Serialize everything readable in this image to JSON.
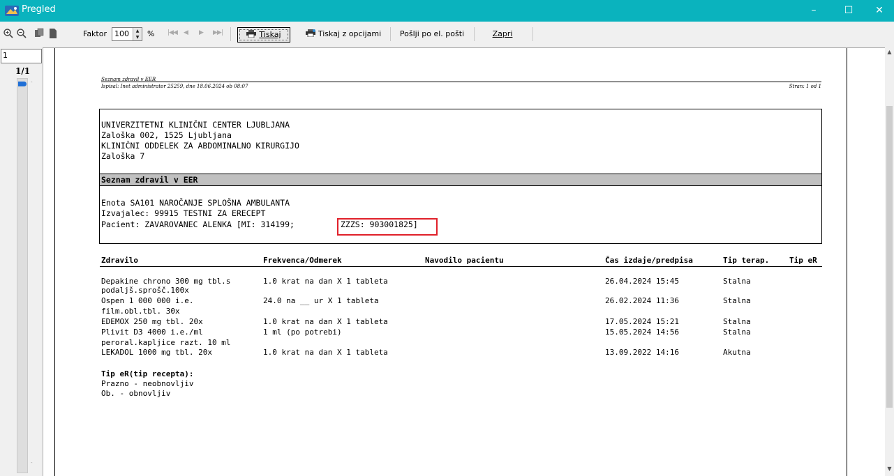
{
  "window": {
    "title": "Pregled",
    "minimize": "–",
    "maximize": "☐",
    "close": "✕"
  },
  "toolbar": {
    "faktor_label": "Faktor",
    "faktor_value": "100",
    "percent_label": "%",
    "print_label": "Tiskaj",
    "print_options_label": "Tiskaj z opcijami",
    "email_label": "Pošlji po el. pošti",
    "close_label": "Zapri"
  },
  "navigator": {
    "page_input": "1",
    "page_count": "1/1"
  },
  "report": {
    "header_title": "Seznam zdravil v EER",
    "header_printed": "Ispisal: Inet administrator 25259, dne 18.06.2024 ob 08:07",
    "header_page": "Stran: 1 od 1",
    "org_lines": [
      "UNIVERZITETNI KLINIČNI CENTER LJUBLJANA",
      "Zaloška 002, 1525 Ljubljana",
      "KLINIČNI ODDELEK ZA ABDOMINALNO KIRURGIJO",
      "Zaloška 7"
    ],
    "section_title": "Seznam zdravil v EER",
    "unit_line": "Enota SA101 NAROČANJE SPLOŠNA AMBULANTA",
    "provider_line": "Izvajalec: 99915 TESTNI ZA ERECEPT",
    "patient_prefix": "Pacient: ZAVAROVANEC ALENKA [MI:  314199;",
    "patient_zzzs": "ZZZS: 903001825]",
    "columns": [
      "Zdravilo",
      "Frekvenca/Odmerek",
      "Navodilo pacientu",
      "Čas izdaje/predpisa",
      "Tip terap.",
      "Tip eR"
    ],
    "rows": [
      {
        "drug": [
          "Depakine chrono 300 mg tbl.s",
          "podaljš.sprošč.100x"
        ],
        "freq": "1.0 krat na dan X 1 tableta",
        "time": "26.04.2024 15:45",
        "therapy": "Stalna"
      },
      {
        "drug": [
          "Ospen 1 000 000 i.e.",
          "film.obl.tbl. 30x"
        ],
        "freq": "24.0 na __ ur X 1 tableta",
        "time": "26.02.2024 11:36",
        "therapy": "Stalna"
      },
      {
        "drug": [
          "EDEMOX 250 mg tbl. 20x"
        ],
        "freq": "1.0 krat na dan X 1 tableta",
        "time": "17.05.2024 15:21",
        "therapy": "Stalna"
      },
      {
        "drug": [
          "Plivit D3 4000 i.e./ml",
          "peroral.kapljice razt. 10 ml"
        ],
        "freq": "1 ml (po potrebi)",
        "time": "15.05.2024 14:56",
        "therapy": "Stalna"
      },
      {
        "drug": [
          "LEKADOL 1000 mg tbl. 20x"
        ],
        "freq": "1.0 krat na dan X 1 tableta",
        "time": "13.09.2022 14:16",
        "therapy": "Akutna"
      }
    ],
    "legend_title": "Tip eR(tip recepta):",
    "legend_items": [
      "Prazno - neobnovljiv",
      "Ob. - obnovljiv"
    ]
  },
  "colors": {
    "titlebar": "#0ab3be",
    "highlight": "#e0202a",
    "band": "#c0c0c0"
  }
}
